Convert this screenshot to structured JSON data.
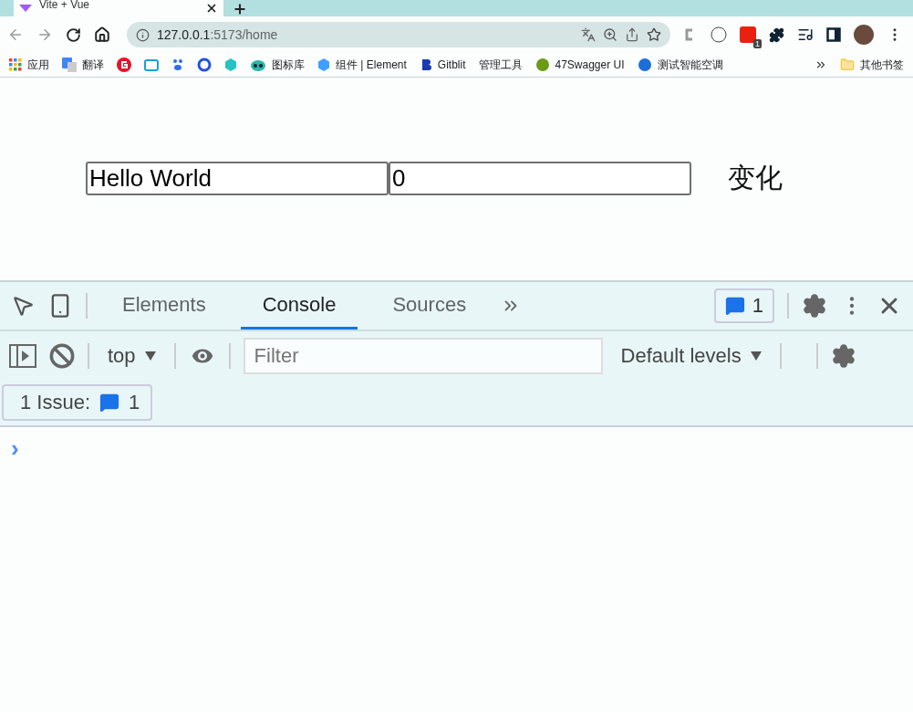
{
  "browser_tabs": [
    {
      "title": "Vite + Vue",
      "selected": true
    }
  ],
  "address_bar": {
    "host": "127.0.0.1",
    "path": ":5173/home"
  },
  "extension_badge": "1",
  "bookmarks": [
    {
      "kind": "apps",
      "label": "应用"
    },
    {
      "kind": "translate",
      "label": "翻译"
    },
    {
      "kind": "red-g"
    },
    {
      "kind": "tv"
    },
    {
      "kind": "paw"
    },
    {
      "kind": "blue-ring"
    },
    {
      "kind": "cyan-hex"
    },
    {
      "kind": "alien",
      "label": "图标库"
    },
    {
      "kind": "cube",
      "label": "组件 | Element"
    },
    {
      "kind": "b-letter",
      "label": "Gitblit"
    },
    {
      "kind": "none",
      "label": "管理工具"
    },
    {
      "kind": "green-h",
      "label": "47Swagger UI"
    },
    {
      "kind": "blue-h",
      "label": "测试智能空调"
    }
  ],
  "other_bookmarks": "其他书签",
  "page": {
    "inputs": [
      "Hello World",
      "0"
    ],
    "label": "变化"
  },
  "devtools": {
    "tabs": [
      {
        "label": "Elements",
        "selected": false
      },
      {
        "label": "Console",
        "selected": true
      },
      {
        "label": "Sources",
        "selected": false
      }
    ],
    "issues_count": "1",
    "context": "top",
    "filter_placeholder": "Filter",
    "levels": "Default levels",
    "issues_label": "1 Issue:",
    "issues_bar_count": "1",
    "prompt": "›"
  }
}
